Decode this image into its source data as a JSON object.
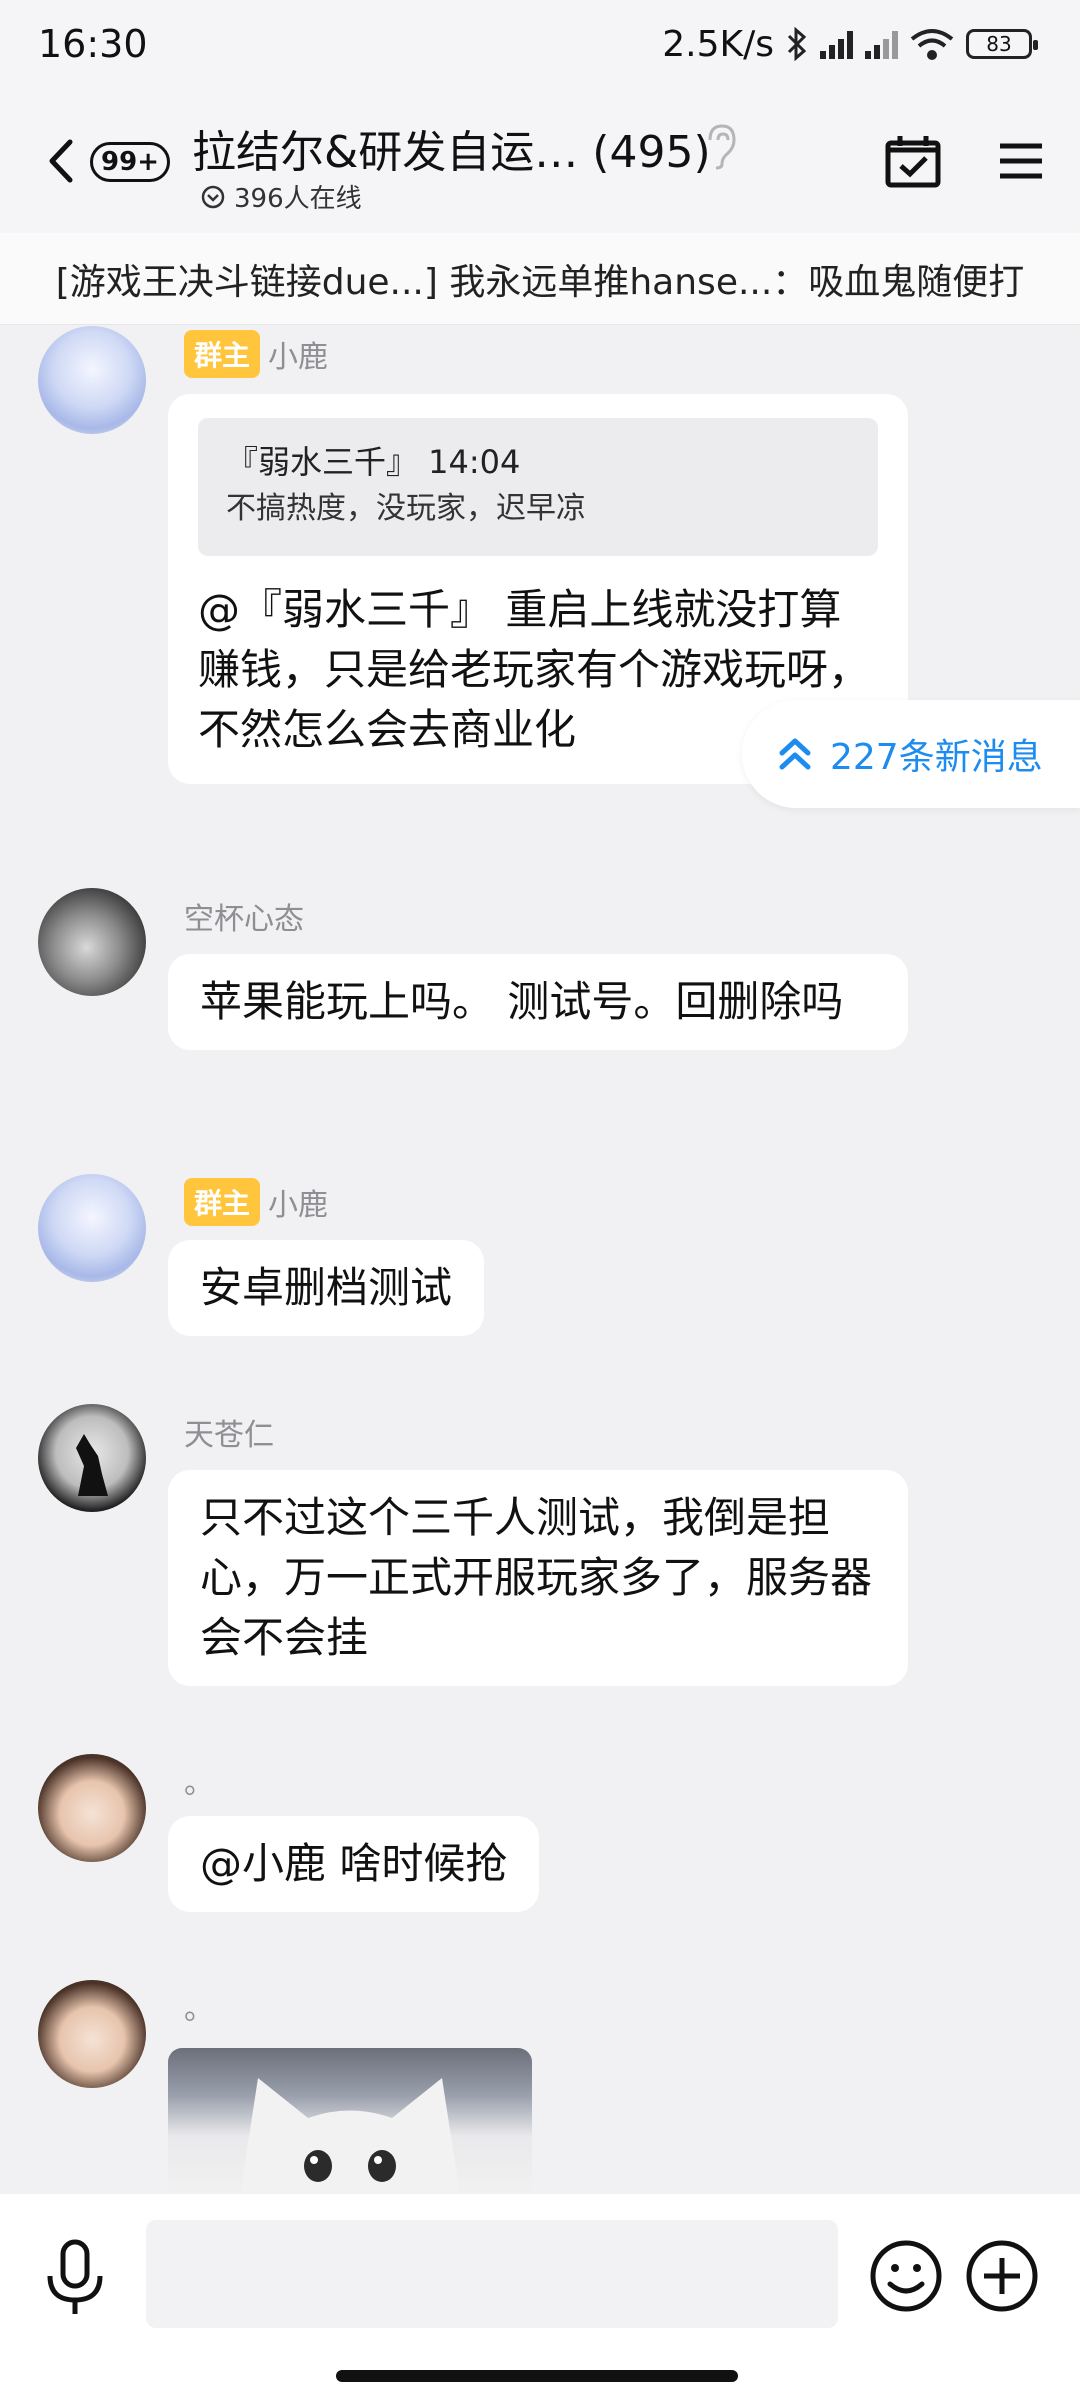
{
  "status": {
    "time": "16:30",
    "net_speed": "2.5K/s",
    "battery": "83"
  },
  "header": {
    "unread_badge": "99+",
    "title": "拉结尔&研发自运… (495)",
    "online": "396人在线"
  },
  "notice": "[游戏王决斗链接due...] 我永远单推hanse...：吸血鬼随便打",
  "new_messages": "227条新消息",
  "messages": [
    {
      "owner_tag": "群主",
      "sender": "小鹿",
      "quote_head": "『弱水三千』 14:04",
      "quote_body": "不搞热度，没玩家，迟早凉",
      "text": "@『弱水三千』 重启上线就没打算赚钱，只是给老玩家有个游戏玩呀，不然怎么会去商业化"
    },
    {
      "sender": "空杯心态",
      "text": "苹果能玩上吗。 测试号。回删除吗"
    },
    {
      "owner_tag": "群主",
      "sender": "小鹿",
      "text": "安卓删档测试"
    },
    {
      "sender": "天苍仁",
      "text": "只不过这个三千人测试，我倒是担心，万一正式开服玩家多了，服务器会不会挂"
    },
    {
      "sender": "。",
      "text": "@小鹿 啥时候抢"
    },
    {
      "sender": "。"
    }
  ],
  "icons": {
    "back": "chevron-left-icon",
    "ear": "ear-icon",
    "calendar": "calendar-check-icon",
    "menu": "menu-icon",
    "mic": "microphone-icon",
    "emoji": "emoji-icon",
    "plus": "plus-circle-icon"
  },
  "colors": {
    "accent": "#1d8cf0",
    "owner_tag": "#ffc53d",
    "background": "#f1f1f3"
  }
}
